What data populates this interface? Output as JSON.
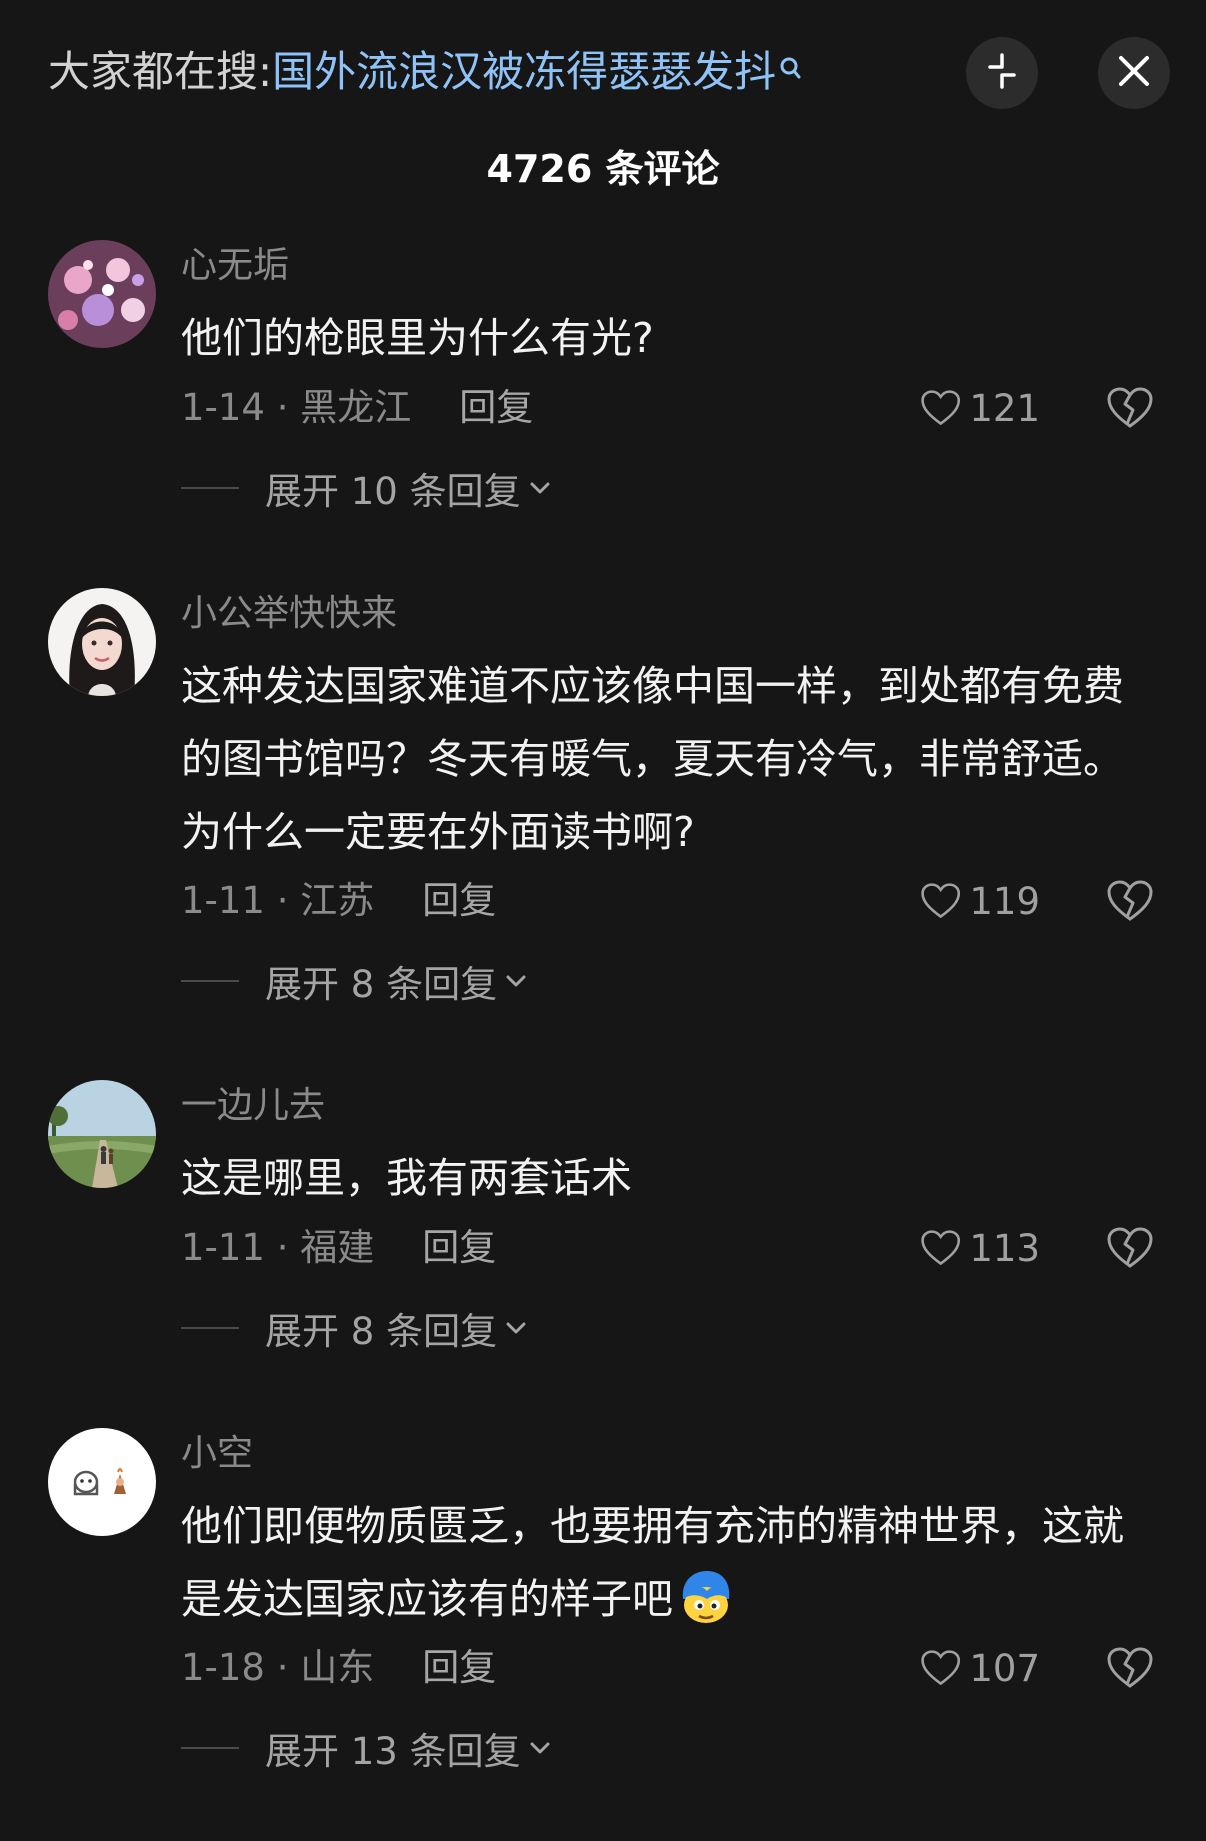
{
  "header": {
    "search_prefix": "大家都在搜:",
    "search_query": "国外流浪汉被冻得瑟瑟发抖",
    "search_icon": "search-icon",
    "collapse_icon": "collapse-icon",
    "close_icon": "close-icon"
  },
  "comments_count": "4726 条评论",
  "comments": [
    {
      "username": "心无垢",
      "text": "他们的枪眼里为什么有光?",
      "meta": "1-14 · 黑龙江",
      "reply": "回复",
      "likes": "121",
      "expand": "展开 10 条回复"
    },
    {
      "username": "小公举快快来",
      "text": "这种发达国家难道不应该像中国一样，到处都有免费的图书馆吗？冬天有暖气，夏天有冷气，非常舒适。为什么一定要在外面读书啊?",
      "meta": "1-11 · 江苏",
      "reply": "回复",
      "likes": "119",
      "expand": "展开 8 条回复"
    },
    {
      "username": "一边儿去",
      "text": "这是哪里，我有两套话术",
      "meta": "1-11 · 福建",
      "reply": "回复",
      "likes": "113",
      "expand": "展开 8 条回复"
    },
    {
      "username": "小空",
      "text": "他们即便物质匮乏，也要拥有充沛的精神世界，这就是发达国家应该有的样子吧",
      "meta": "1-18 · 山东",
      "reply": "回复",
      "likes": "107",
      "expand": "展开 13 条回复"
    }
  ],
  "colors": {
    "background": "#161616",
    "link": "#8fc3f7",
    "muted": "#8a8a8a"
  }
}
